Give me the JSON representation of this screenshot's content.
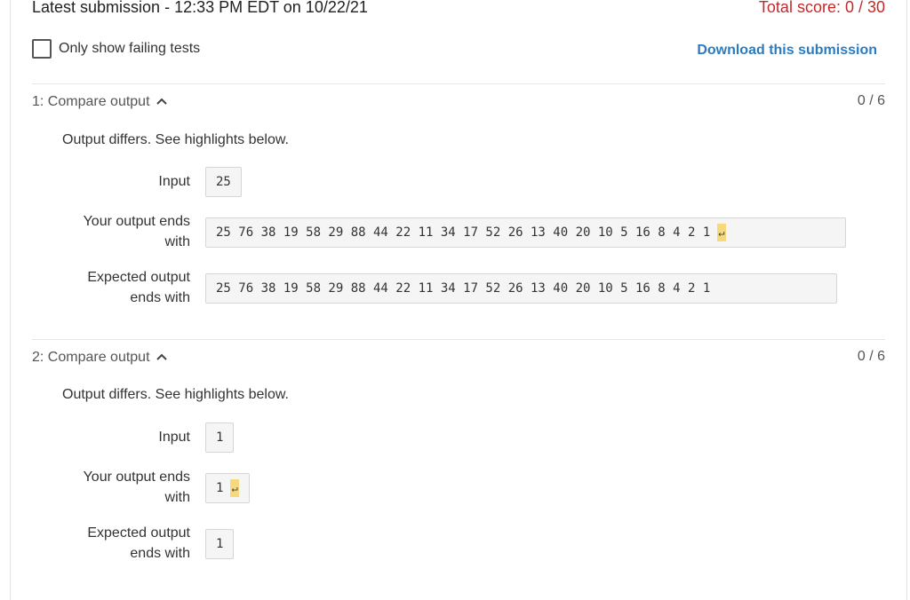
{
  "header": {
    "title": "Latest submission - 12:33 PM EDT on 10/22/21",
    "total_score": "Total score: 0 / 30"
  },
  "filter": {
    "label": "Only show failing tests",
    "checked": false
  },
  "download_label": "Download this submission",
  "tests": [
    {
      "title": "1: Compare output",
      "score": "0 / 6",
      "message": "Output differs. See highlights below.",
      "input_label": "Input",
      "input_value": "25",
      "your_label_line1": "Your output ends",
      "your_label_line2": "with",
      "your_value": "25 76 38 19 58 29 88 44 22 11 34 17 52 26 13 40 20 10 5 16 8 4 2 1",
      "expected_label_line1": "Expected output",
      "expected_label_line2": "ends with",
      "expected_value": "25 76 38 19 58 29 88 44 22 11 34 17 52 26 13 40 20 10 5 16 8 4 2 1"
    },
    {
      "title": "2: Compare output",
      "score": "0 / 6",
      "message": "Output differs. See highlights below.",
      "input_label": "Input",
      "input_value": "1",
      "your_label_line1": "Your output ends",
      "your_label_line2": "with",
      "your_value": "1",
      "expected_label_line1": "Expected output",
      "expected_label_line2": "ends with",
      "expected_value": "1"
    }
  ],
  "icons": {
    "chevron": "chevron-up-icon",
    "newline": "newline-return-icon"
  },
  "colors": {
    "score_red": "#c62828",
    "link_blue": "#2b7bc0",
    "newline_highlight": "#f6d97a"
  }
}
